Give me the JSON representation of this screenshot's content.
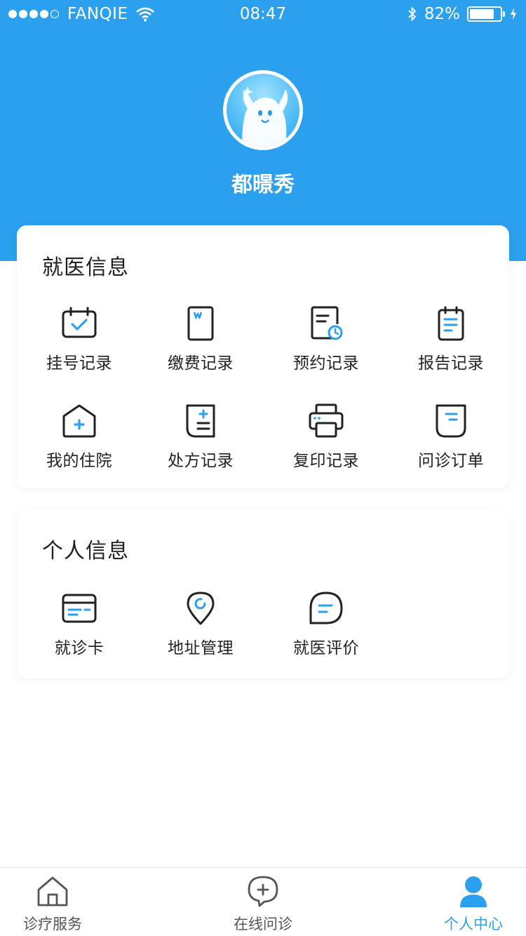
{
  "status_bar": {
    "carrier": "FANQIE",
    "time": "08:47",
    "battery": "82%",
    "battery_level": 0.82
  },
  "profile": {
    "username": "都暻秀"
  },
  "medical_info": {
    "title": "就医信息",
    "items": [
      {
        "label": "挂号记录",
        "icon": "calendar-check-icon"
      },
      {
        "label": "缴费记录",
        "icon": "document-w-icon"
      },
      {
        "label": "预约记录",
        "icon": "document-clock-icon"
      },
      {
        "label": "报告记录",
        "icon": "clipboard-icon"
      },
      {
        "label": "我的住院",
        "icon": "hospital-house-icon"
      },
      {
        "label": "处方记录",
        "icon": "prescription-icon"
      },
      {
        "label": "复印记录",
        "icon": "printer-icon"
      },
      {
        "label": "问诊订单",
        "icon": "order-icon"
      }
    ]
  },
  "personal_info": {
    "title": "个人信息",
    "items": [
      {
        "label": "就诊卡",
        "icon": "card-icon"
      },
      {
        "label": "地址管理",
        "icon": "location-pin-icon"
      },
      {
        "label": "就医评价",
        "icon": "chat-bubble-icon"
      }
    ]
  },
  "tabbar": {
    "items": [
      {
        "label": "诊疗服务",
        "icon": "home-icon"
      },
      {
        "label": "在线问诊",
        "icon": "chat-plus-icon"
      },
      {
        "label": "个人中心",
        "icon": "user-icon"
      }
    ],
    "active_index": 2
  },
  "colors": {
    "primary": "#2aa0ee",
    "icon_dark": "#222222",
    "icon_accent": "#2aa0ee",
    "text": "#222222",
    "tab_inactive": "#555555"
  }
}
